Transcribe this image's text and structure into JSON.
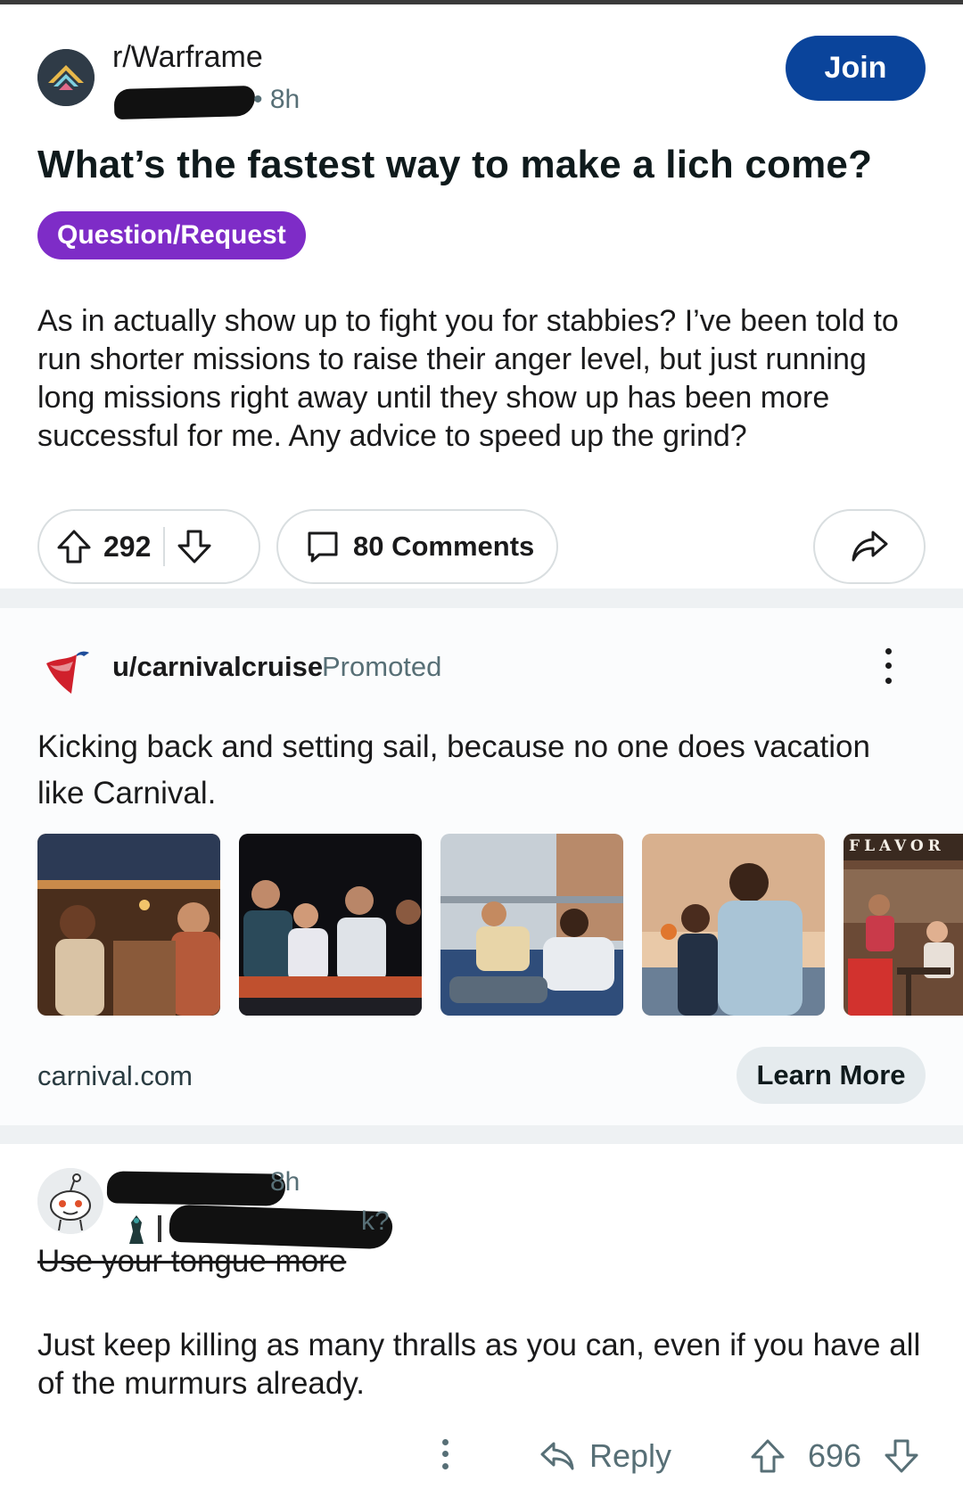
{
  "post": {
    "subreddit": "r/Warframe",
    "time": "• 8h",
    "join_label": "Join",
    "title": "What’s the fastest way to make a lich come?",
    "flair": "Question/Request",
    "body": "As in actually show up to fight you for stabbies? I’ve been told to run shorter missions to raise their anger level, but just running long missions right away until they show up has been more successful for me. Any advice to speed up the grind?",
    "votes": "292",
    "comments_label": "80 Comments",
    "icons": [
      "upvote-icon",
      "downvote-icon",
      "comment-icon",
      "share-icon"
    ]
  },
  "ad": {
    "user": "u/carnivalcruise",
    "promoted": "Promoted",
    "text": "Kicking back and setting sail, because no one does vacation like Carnival.",
    "images": [
      "bar-toast-photo",
      "game-show-photo",
      "deck-lounge-photo",
      "sunset-drink-photo",
      "flavor-restaurant-photo"
    ],
    "image_sign": "FLAVOR",
    "domain": "carnival.com",
    "cta": "Learn More",
    "brand_color": "#d0202c"
  },
  "comment": {
    "time": "8h",
    "flair_tail": "k?",
    "strike_text": "Use your tongue more",
    "body": "Just keep killing as many thralls as you can, even if you have all of the murmurs already.",
    "reply_label": "Reply",
    "votes": "696"
  },
  "colors": {
    "join_bg": "#0a449b",
    "flair_bg": "#7e2cc7",
    "separator": "#eef1f3",
    "meta_text": "#576f76"
  }
}
